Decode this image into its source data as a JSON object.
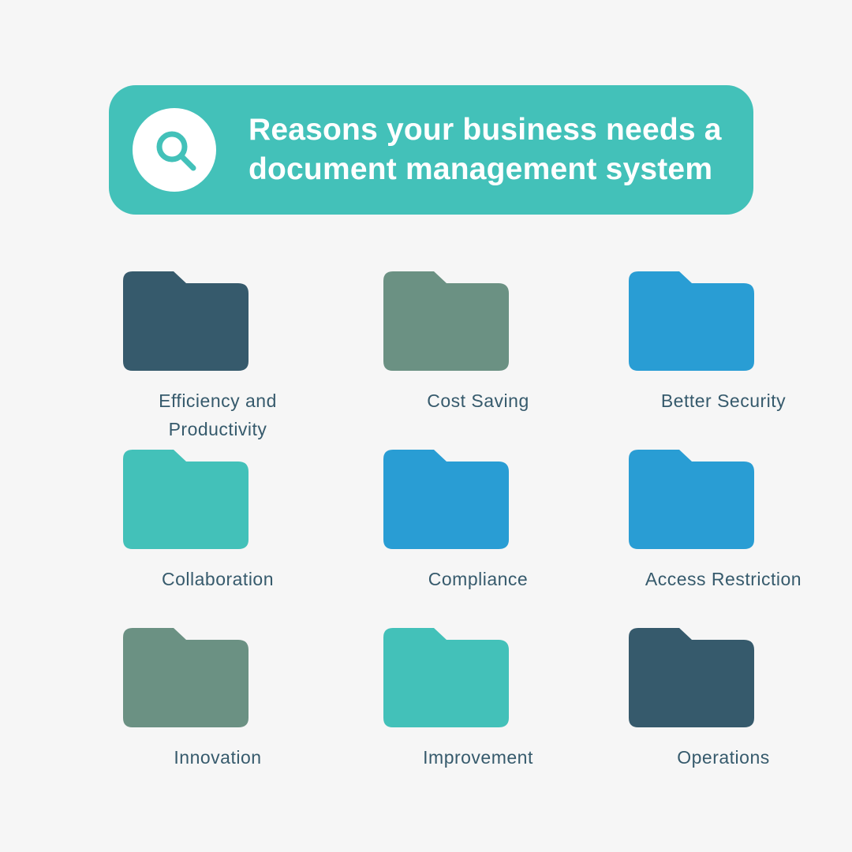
{
  "header": {
    "icon": "search-icon",
    "title_lines": [
      "Reasons your business needs a",
      "document management system"
    ]
  },
  "colors": {
    "background": "#f6f6f6",
    "banner": "#43c1b9",
    "label_text": "#365a6c"
  },
  "items": [
    {
      "label": "Efficiency and Productivity",
      "lines": [
        "Efficiency and",
        "Productivity"
      ],
      "icon": "folder-icon",
      "color": "#365a6c"
    },
    {
      "label": "Cost Saving",
      "lines": [
        "Cost Saving"
      ],
      "icon": "folder-icon",
      "color": "#6b9183"
    },
    {
      "label": "Better Security",
      "lines": [
        "Better Security"
      ],
      "icon": "folder-icon",
      "color": "#299dd4"
    },
    {
      "label": "Collaboration",
      "lines": [
        "Collaboration"
      ],
      "icon": "folder-icon",
      "color": "#43c1b9"
    },
    {
      "label": "Compliance",
      "lines": [
        "Compliance"
      ],
      "icon": "folder-icon",
      "color": "#299dd4"
    },
    {
      "label": "Access Restriction",
      "lines": [
        "Access Restriction"
      ],
      "icon": "folder-icon",
      "color": "#299dd4"
    },
    {
      "label": "Innovation",
      "lines": [
        "Innovation"
      ],
      "icon": "folder-icon",
      "color": "#6b9183"
    },
    {
      "label": "Improvement",
      "lines": [
        "Improvement"
      ],
      "icon": "folder-icon",
      "color": "#43c1b9"
    },
    {
      "label": "Operations",
      "lines": [
        "Operations"
      ],
      "icon": "folder-icon",
      "color": "#365a6c"
    }
  ]
}
